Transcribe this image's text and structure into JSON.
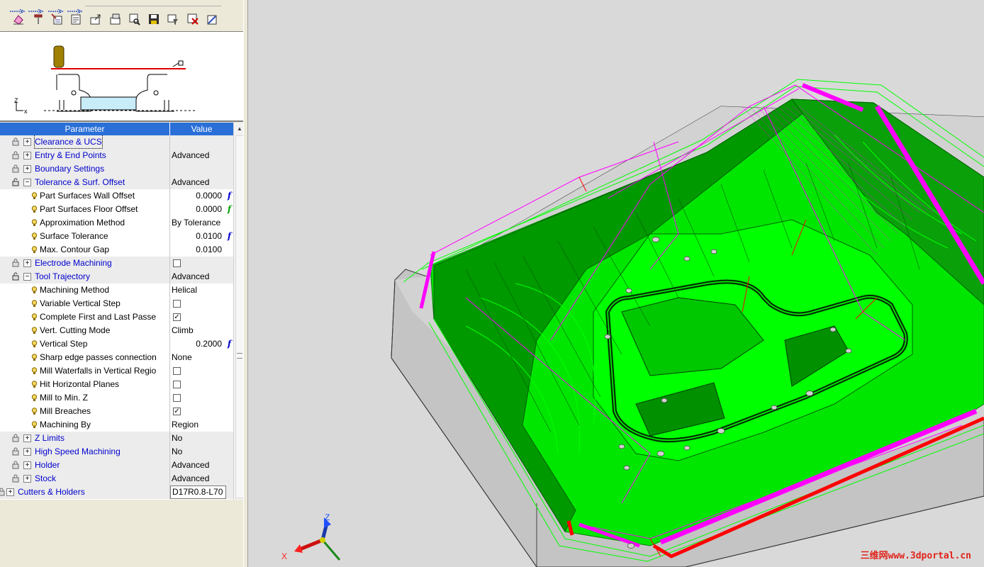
{
  "toolbar": {
    "icons": [
      "clear-icon",
      "tool-icon",
      "parameters-icon",
      "edit-icon",
      "export-icon",
      "import-icon",
      "search-icon",
      "save-icon",
      "filter-icon",
      "delete-icon",
      "close-icon"
    ]
  },
  "preview": {
    "axis_z": "Z",
    "axis_x": "x"
  },
  "grid": {
    "header_param": "Parameter",
    "header_value": "Value",
    "rows": [
      {
        "label": "Clearance & UCS",
        "value": ""
      },
      {
        "label": "Entry & End Points",
        "value": "Advanced"
      },
      {
        "label": "Boundary Settings",
        "value": ""
      },
      {
        "label": "Tolerance & Surf. Offset",
        "value": "Advanced"
      },
      {
        "label": "Part Surfaces Wall Offset",
        "value": "0.0000"
      },
      {
        "label": "Part Surfaces Floor Offset",
        "value": "0.0000"
      },
      {
        "label": "Approximation Method",
        "value": "By Tolerance"
      },
      {
        "label": "Surface Tolerance",
        "value": "0.0100"
      },
      {
        "label": "Max. Contour Gap",
        "value": "0.0100"
      },
      {
        "label": "Electrode Machining",
        "value": ""
      },
      {
        "label": "Tool Trajectory",
        "value": "Advanced"
      },
      {
        "label": "Machining Method",
        "value": "Helical"
      },
      {
        "label": "Variable Vertical Step",
        "value": ""
      },
      {
        "label": "Complete First and Last Passe",
        "value": ""
      },
      {
        "label": "Vert. Cutting Mode",
        "value": "Climb"
      },
      {
        "label": "Vertical Step",
        "value": "0.2000"
      },
      {
        "label": "Sharp edge passes connection",
        "value": "None"
      },
      {
        "label": "Mill Waterfalls in Vertical Regio",
        "value": ""
      },
      {
        "label": "Hit Horizontal Planes",
        "value": ""
      },
      {
        "label": "Mill to Min. Z",
        "value": ""
      },
      {
        "label": "Mill Breaches",
        "value": ""
      },
      {
        "label": "Machining By",
        "value": "Region"
      },
      {
        "label": "Z Limits",
        "value": "No"
      },
      {
        "label": "High Speed Machining",
        "value": "No"
      },
      {
        "label": "Holder",
        "value": "Advanced"
      },
      {
        "label": "Stock",
        "value": "Advanced"
      },
      {
        "label": "Cutters & Holders",
        "value": "D17R0.8-L70"
      }
    ],
    "fx_symbol": "f",
    "check_mark": "✓",
    "expand_plus": "+",
    "expand_minus": "−"
  },
  "viewport": {
    "axis_labels": {
      "z": "Z",
      "x": "X"
    },
    "watermark": "三维网www.3dportal.cn"
  },
  "colors": {
    "toolpath_green": "#00ff00",
    "part_green": "#009900",
    "retract_magenta": "#ff00ff",
    "rapid_red": "#ff0000",
    "stock_grey": "#c8c8c8",
    "header_blue": "#2a6fd8",
    "group_label_blue": "#0000cc"
  }
}
